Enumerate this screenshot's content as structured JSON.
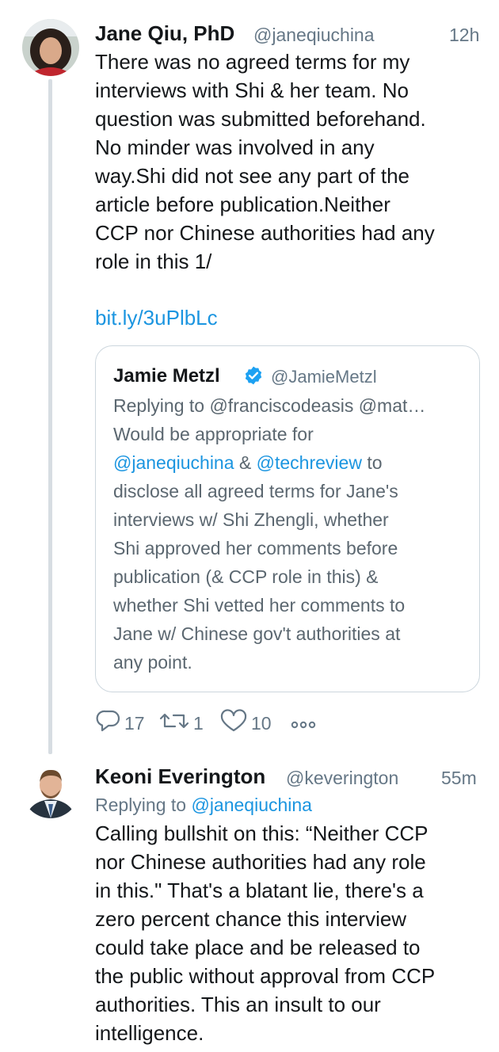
{
  "tweet1": {
    "name": "Jane Qiu, PhD",
    "handle": "@janeqiuchina",
    "time": "12h",
    "text_lines": [
      "There was no agreed terms for my",
      "interviews with Shi & her team. No",
      "question was submitted beforehand.",
      "No minder was involved in any",
      "way.Shi did not see any part of the",
      "article before publication.Neither",
      "CCP nor Chinese authorities had any",
      "role in this 1/"
    ],
    "link": "bit.ly/3uPlbLc",
    "quote": {
      "name": "Jamie Metzl",
      "handle": "@JamieMetzl",
      "replying": "Replying to @franciscodeasis @mat…",
      "line1": "Would be appropriate for",
      "mention1": "@janeqiuchina",
      "amp": " & ",
      "mention2": "@techreview",
      "line2_rest": " to",
      "lines": [
        "disclose all agreed terms for Jane's",
        "interviews w/ Shi Zhengli, whether",
        "Shi approved her comments before",
        "publication (& CCP role in this) &",
        "whether Shi vetted her comments to",
        "Jane w/ Chinese gov't authorities at",
        "any point."
      ]
    },
    "actions": {
      "replies": "17",
      "retweets": "1",
      "likes": "10"
    }
  },
  "tweet2": {
    "name": "Keoni Everington",
    "handle": "@keverington",
    "time": "55m",
    "replying_prefix": "Replying to ",
    "replying_to": "@janeqiuchina",
    "text_lines": [
      "Calling bullshit on this: “Neither CCP",
      "nor Chinese authorities had any role",
      "in this.\" That's a blatant lie, there's a",
      "zero percent chance this interview",
      "could take place and be released to",
      "the public without approval from CCP",
      "authorities. This an insult to our",
      "intelligence."
    ]
  },
  "colors": {
    "link": "#1b95e0",
    "secondary": "#657786",
    "border": "#ccd6dd",
    "verified": "#1da1f2"
  },
  "icons": [
    "reply-icon",
    "retweet-icon",
    "like-icon",
    "more-icon",
    "verified-icon"
  ]
}
